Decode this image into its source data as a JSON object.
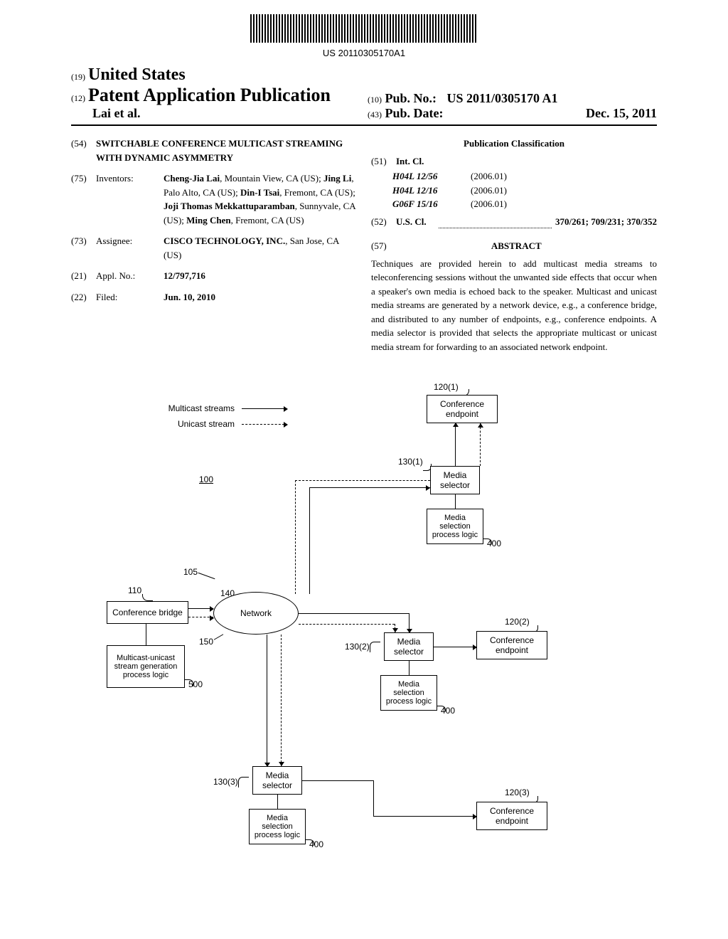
{
  "barcode_number": "US 20110305170A1",
  "header": {
    "country_code": "19",
    "country": "United States",
    "doc_type_code": "12",
    "doc_type": "Patent Application Publication",
    "authors": "Lai et al.",
    "pub_no_code": "10",
    "pub_no_label": "Pub. No.:",
    "pub_no": "US 2011/0305170 A1",
    "pub_date_code": "43",
    "pub_date_label": "Pub. Date:",
    "pub_date": "Dec. 15, 2011"
  },
  "biblio": {
    "title_code": "54",
    "title": "SWITCHABLE CONFERENCE MULTICAST STREAMING WITH DYNAMIC ASYMMETRY",
    "inventors_code": "75",
    "inventors_label": "Inventors:",
    "inventors": "Cheng-Jia Lai, Mountain View, CA (US); Jing Li, Palo Alto, CA (US); Din-I Tsai, Fremont, CA (US); Joji Thomas Mekkattuparamban, Sunnyvale, CA (US); Ming Chen, Fremont, CA (US)",
    "assignee_code": "73",
    "assignee_label": "Assignee:",
    "assignee": "CISCO TECHNOLOGY, INC., San Jose, CA (US)",
    "appl_code": "21",
    "appl_label": "Appl. No.:",
    "appl_no": "12/797,716",
    "filed_code": "22",
    "filed_label": "Filed:",
    "filed": "Jun. 10, 2010"
  },
  "classification": {
    "title": "Publication Classification",
    "int_cl_code": "51",
    "int_cl_label": "Int. Cl.",
    "classes": [
      {
        "code": "H04L 12/56",
        "year": "(2006.01)"
      },
      {
        "code": "H04L 12/16",
        "year": "(2006.01)"
      },
      {
        "code": "G06F 15/16",
        "year": "(2006.01)"
      }
    ],
    "us_cl_code": "52",
    "us_cl_label": "U.S. Cl.",
    "us_cl": "370/261; 709/231; 370/352",
    "abstract_code": "57",
    "abstract_label": "ABSTRACT",
    "abstract": "Techniques are provided herein to add multicast media streams to teleconferencing sessions without the unwanted side effects that occur when a speaker's own media is echoed back to the speaker. Multicast and unicast media streams are generated by a network device, e.g., a conference bridge, and distributed to any number of endpoints, e.g., conference endpoints. A media selector is provided that selects the appropriate multicast or unicast media stream for forwarding to an associated network endpoint."
  },
  "diagram": {
    "legend_multicast": "Multicast streams",
    "legend_unicast": "Unicast stream",
    "ref_100": "100",
    "ref_105": "105",
    "ref_110": "110",
    "ref_140": "140",
    "ref_150": "150",
    "ref_500": "500",
    "ref_120_1": "120(1)",
    "ref_120_2": "120(2)",
    "ref_120_3": "120(3)",
    "ref_130_1": "130(1)",
    "ref_130_2": "130(2)",
    "ref_130_3": "130(3)",
    "ref_400": "400",
    "conference_bridge": "Conference bridge",
    "network": "Network",
    "multicast_unicast_gen": "Multicast-unicast stream generation process logic",
    "media_selector": "Media selector",
    "media_selection_logic": "Media selection process logic",
    "conference_endpoint": "Conference endpoint"
  }
}
